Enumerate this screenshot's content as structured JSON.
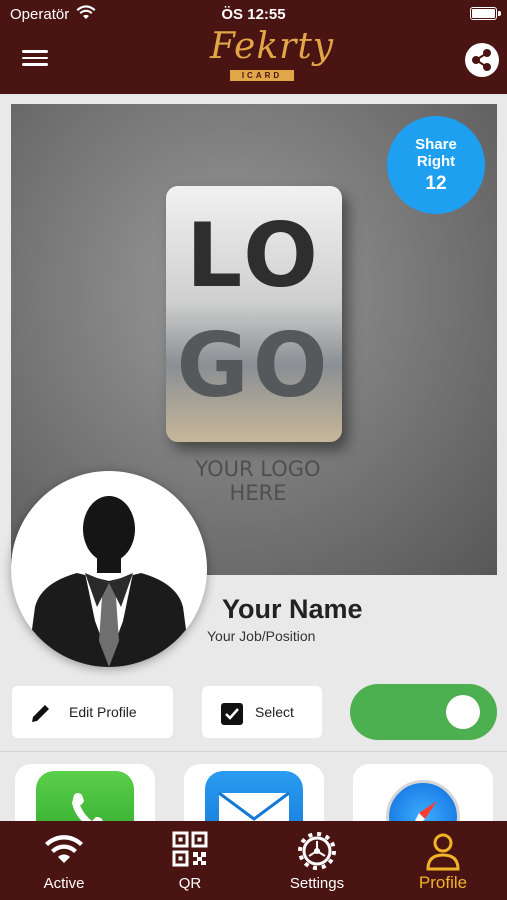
{
  "status_bar": {
    "carrier": "Operatör",
    "time": "ÖS 12:55"
  },
  "header": {
    "brand": "Fekrty",
    "brand_sub": "ICARD"
  },
  "card": {
    "logo_top": "LO",
    "logo_bottom": "GO",
    "logo_caption": "YOUR LOGO HERE",
    "share_right_label": "Share Right",
    "share_right_count": "12",
    "name": "Your Name",
    "job": "Your Job/Position"
  },
  "actions": {
    "edit_label": "Edit Profile",
    "select_label": "Select",
    "toggle_on": true
  },
  "bottom_nav": [
    {
      "label": "Active"
    },
    {
      "label": "QR"
    },
    {
      "label": "Settings"
    },
    {
      "label": "Profile"
    }
  ],
  "colors": {
    "bar": "#4a1412",
    "accent": "#f0b428",
    "share_badge": "#1e9ff0",
    "toggle": "#4caf50"
  }
}
